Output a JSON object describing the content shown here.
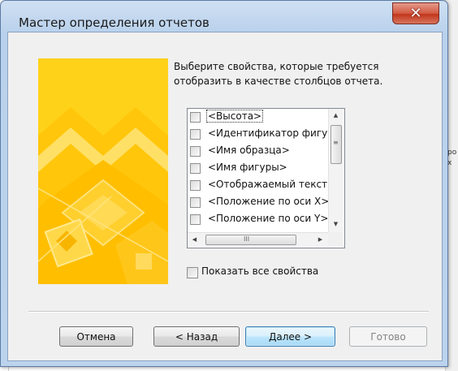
{
  "window": {
    "title": "Мастер определения отчетов",
    "close_glyph": "✕"
  },
  "description": "Выберите свойства, которые требуется\nотобразить в качестве столбцов отчета.",
  "properties_list": {
    "items": [
      {
        "label": "<Высота>",
        "checked": false,
        "focused": true
      },
      {
        "label": "<Идентификатор фигуры",
        "checked": false
      },
      {
        "label": "<Имя образца>",
        "checked": false
      },
      {
        "label": "<Имя фигуры>",
        "checked": false
      },
      {
        "label": "<Отображаемый текст>",
        "checked": false
      },
      {
        "label": "<Положение по оси X>",
        "checked": false
      },
      {
        "label": "<Положение по оси Y>",
        "checked": false
      }
    ],
    "scroll_up_icon": "▲",
    "scroll_down_icon": "▼",
    "scroll_left_icon": "◀",
    "scroll_right_icon": "▶",
    "grip_v": "≡",
    "grip_h": "III"
  },
  "show_all": {
    "label": "Показать все свойства",
    "checked": false
  },
  "buttons": {
    "cancel": "Отмена",
    "back": "< Назад",
    "next": "Далее >",
    "finish": "Готово"
  },
  "background_fragment": {
    "line1": "ро",
    "line2": "х"
  },
  "colors": {
    "banner_yellow": "#ffd21a",
    "accent_blue": "#3c7fb1",
    "close_red": "#c2361c"
  }
}
